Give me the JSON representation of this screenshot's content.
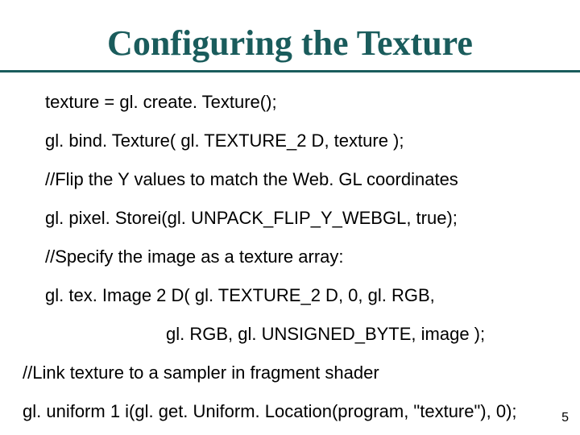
{
  "title": "Configuring the Texture",
  "lines": {
    "l1": "texture = gl. create. Texture();",
    "l2": "gl. bind. Texture( gl. TEXTURE_2 D, texture );",
    "l3": "//Flip the Y values to match the Web. GL coordinates",
    "l4": "gl. pixel. Storei(gl. UNPACK_FLIP_Y_WEBGL, true);",
    "l5": "//Specify the image as a texture array:",
    "l6": "gl. tex. Image 2 D( gl. TEXTURE_2 D, 0, gl. RGB,",
    "l7": "gl. RGB, gl. UNSIGNED_BYTE, image );",
    "l8": "//Link texture to a sampler in fragment shader",
    "l9": "gl. uniform 1 i(gl. get. Uniform. Location(program, \"texture\"), 0);"
  },
  "page_number": "5"
}
